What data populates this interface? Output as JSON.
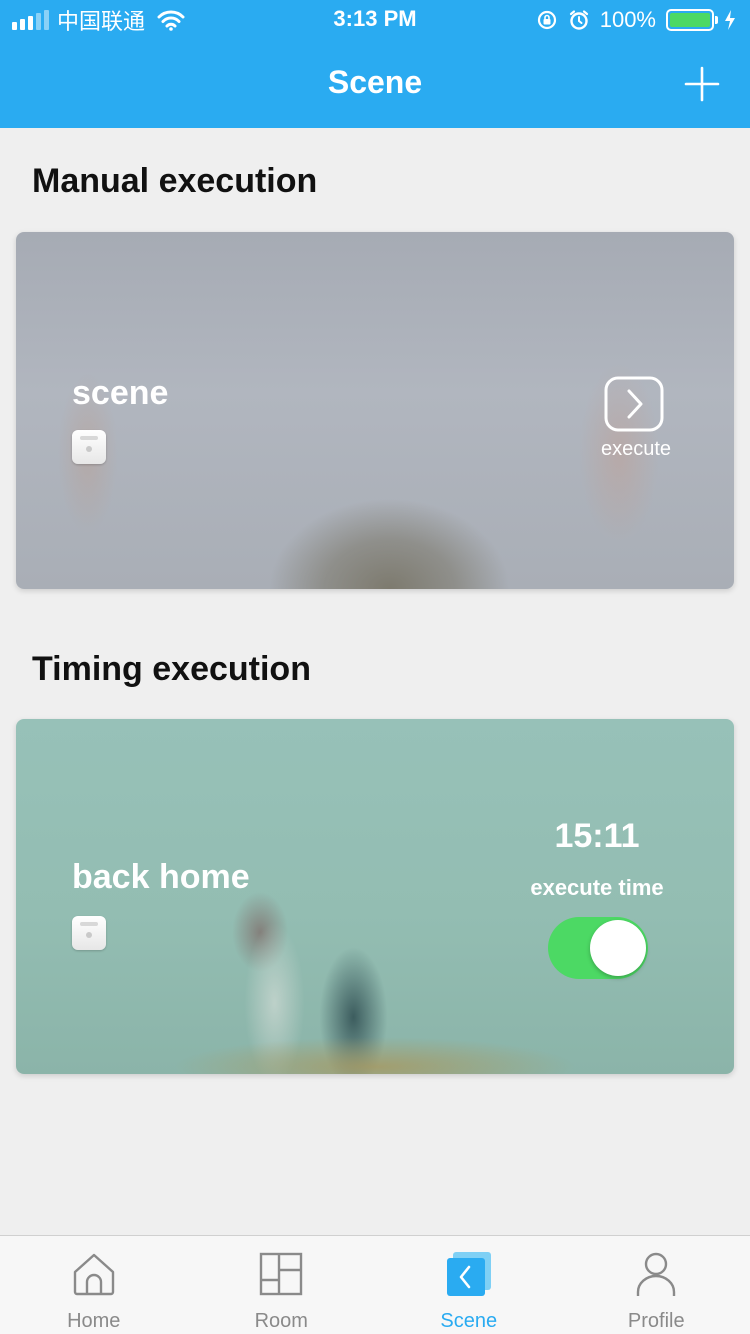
{
  "status_bar": {
    "carrier": "中国联通",
    "time": "3:13 PM",
    "battery_percent": "100%",
    "battery_level": 1.0,
    "icons": [
      "signal-icon",
      "wifi-icon",
      "orientation-lock-icon",
      "alarm-icon",
      "battery-icon",
      "charging-icon"
    ]
  },
  "header": {
    "title": "Scene",
    "add_icon": "plus-icon"
  },
  "manual": {
    "section_title": "Manual execution",
    "scene_name": "scene",
    "device_icon": "smart-plug-icon",
    "execute_icon": "chevron-right-icon",
    "execute_label": "execute"
  },
  "timing": {
    "section_title": "Timing execution",
    "scene_name": "back home",
    "device_icon": "smart-plug-icon",
    "time": "15:11",
    "time_label": "execute time",
    "toggle_on": true
  },
  "tabs": [
    {
      "label": "Home",
      "icon": "home-icon",
      "active": false
    },
    {
      "label": "Room",
      "icon": "room-grid-icon",
      "active": false
    },
    {
      "label": "Scene",
      "icon": "scene-icon",
      "active": true
    },
    {
      "label": "Profile",
      "icon": "profile-icon",
      "active": false
    }
  ],
  "colors": {
    "accent": "#2aabf1",
    "toggle_on": "#4cd964",
    "tab_inactive": "#8a8a8a"
  }
}
